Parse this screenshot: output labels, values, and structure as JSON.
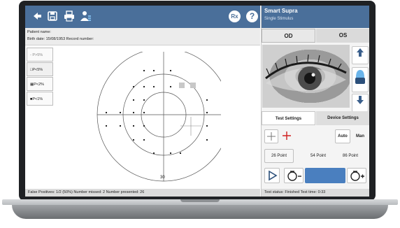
{
  "toolbar": {
    "icons": [
      "back-arrow-icon",
      "save-icon",
      "print-icon",
      "patient-icon"
    ],
    "rx_label": "Rx",
    "help_label": "?"
  },
  "patient": {
    "name_label": "Patient name:",
    "details": "Birth date: 15/08/1953   Record number:"
  },
  "legend": [
    {
      "label": "- P>5%"
    },
    {
      "label": "□P<5%"
    },
    {
      "label": "▦P<2%"
    },
    {
      "label": "■P<1%"
    }
  ],
  "plot": {
    "scale_label": "30"
  },
  "status_left": "False Positives: 1/2 (50%)   Number missed: 2   Number presented: 26",
  "right": {
    "title": "Smart Supra",
    "subtitle": "Single Stimulus",
    "eye_tabs": [
      "OD",
      "OS"
    ],
    "settings_tabs": [
      "Test Settings",
      "Device Settings"
    ],
    "auto_label": "Auto",
    "man_label": "Man",
    "points": [
      "26 Point",
      "54 Point",
      "86 Point"
    ],
    "status": "Test status: Finished   Test time: 0:33"
  },
  "colors": {
    "header_blue": "#4a6f9a",
    "accent_blue": "#4a7fbf",
    "cross_red": "#d02020"
  }
}
